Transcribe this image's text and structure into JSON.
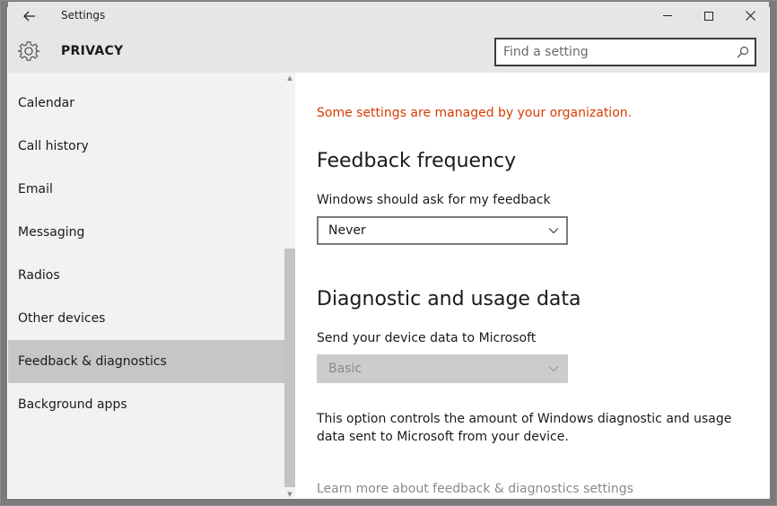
{
  "window": {
    "title": "Settings"
  },
  "header": {
    "section_title": "PRIVACY",
    "search_placeholder": "Find a setting"
  },
  "sidebar": {
    "items": [
      {
        "label": "Calendar",
        "selected": false
      },
      {
        "label": "Call history",
        "selected": false
      },
      {
        "label": "Email",
        "selected": false
      },
      {
        "label": "Messaging",
        "selected": false
      },
      {
        "label": "Radios",
        "selected": false
      },
      {
        "label": "Other devices",
        "selected": false
      },
      {
        "label": "Feedback & diagnostics",
        "selected": true
      },
      {
        "label": "Background apps",
        "selected": false
      }
    ]
  },
  "main": {
    "notice": "Some settings are managed by your organization.",
    "feedback": {
      "heading": "Feedback frequency",
      "label": "Windows should ask for my feedback",
      "selected": "Never"
    },
    "diagnostics": {
      "heading": "Diagnostic and usage data",
      "label": "Send your device data to Microsoft",
      "selected": "Basic",
      "description": "This option controls the amount of Windows diagnostic and usage data sent to Microsoft from your device."
    },
    "learn_more": "Learn more about feedback & diagnostics settings"
  },
  "colors": {
    "notice": "#d83b01",
    "selected_item": "#c6c6c6",
    "chrome": "#e6e6e6"
  },
  "icons": {
    "back": "back-arrow-icon",
    "minimize": "minimize-icon",
    "maximize": "maximize-icon",
    "close": "close-icon",
    "gear": "gear-icon",
    "search": "search-icon",
    "dropdown": "chevron-down-icon"
  }
}
